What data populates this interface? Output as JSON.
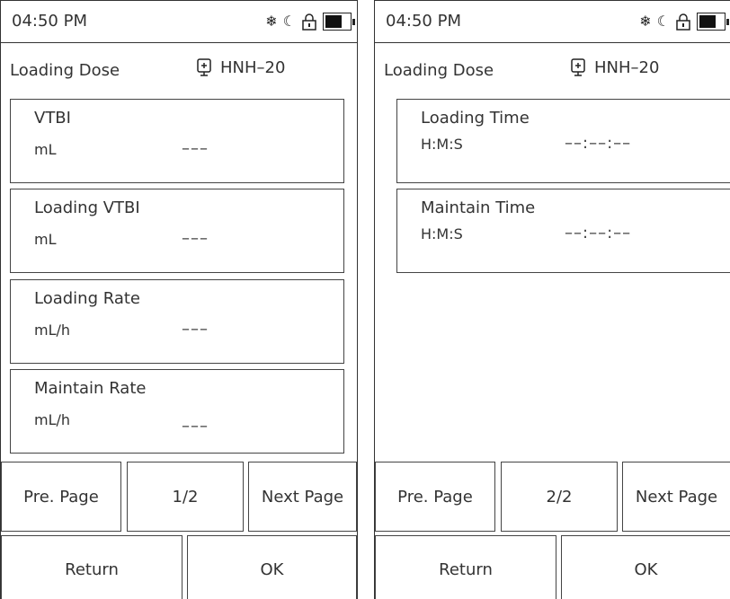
{
  "screens": [
    {
      "status": {
        "time": "04:50 PM"
      },
      "title": "Loading Dose",
      "device_id": "HNH–20",
      "fields": [
        {
          "label": "VTBI",
          "unit": "mL",
          "value": "–––"
        },
        {
          "label": "Loading VTBI",
          "unit": "mL",
          "value": "–––"
        },
        {
          "label": "Loading Rate",
          "unit": "mL/h",
          "value": "–––"
        },
        {
          "label": "Maintain Rate",
          "unit": "mL/h",
          "value": "–––"
        }
      ],
      "pager": {
        "prev": "Pre. Page",
        "indicator": "1/2",
        "next": "Next Page"
      },
      "actions": {
        "return": "Return",
        "ok": "OK"
      }
    },
    {
      "status": {
        "time": "04:50 PM"
      },
      "title": "Loading Dose",
      "device_id": "HNH–20",
      "fields": [
        {
          "label": "Loading Time",
          "unit": "H:M:S",
          "value": "––:––:––"
        },
        {
          "label": "Maintain Time",
          "unit": "H:M:S",
          "value": "––:––:––"
        }
      ],
      "pager": {
        "prev": "Pre. Page",
        "indicator": "2/2",
        "next": "Next Page"
      },
      "actions": {
        "return": "Return",
        "ok": "OK"
      }
    }
  ],
  "icons": {
    "snowflake": "snowflake-icon",
    "night_mode": "night-mode-icon",
    "lock": "lock-icon",
    "battery": "battery-icon",
    "device": "infusion-bag-icon"
  },
  "battery_level": 0.7
}
